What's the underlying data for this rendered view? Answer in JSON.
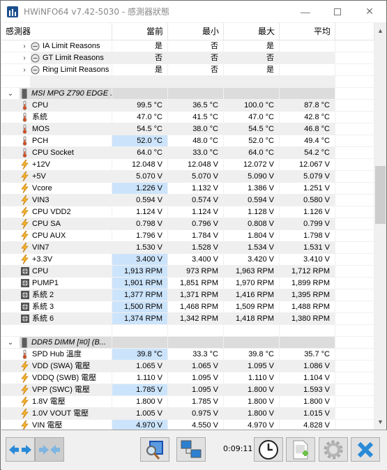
{
  "window": {
    "title": "HWiNFO64 v7.42-5030 - 感測器狀態",
    "minimize_glyph": "—",
    "close_glyph": "✕"
  },
  "columns": [
    "感測器",
    "當前",
    "最小",
    "最大",
    "平均"
  ],
  "rows": [
    {
      "type": "item",
      "indent": 2,
      "expander": "›",
      "icon": "clock-icon",
      "label": "IA Limit Reasons",
      "values": [
        "是",
        "否",
        "是",
        ""
      ],
      "highlight": [
        false,
        false,
        false,
        false
      ]
    },
    {
      "type": "item",
      "indent": 2,
      "expander": "›",
      "icon": "clock-icon",
      "label": "GT Limit Reasons",
      "values": [
        "否",
        "否",
        "否",
        ""
      ],
      "highlight": [
        false,
        false,
        false,
        false
      ]
    },
    {
      "type": "item",
      "indent": 2,
      "expander": "›",
      "icon": "clock-icon",
      "label": "Ring Limit Reasons",
      "values": [
        "是",
        "否",
        "是",
        ""
      ],
      "highlight": [
        false,
        false,
        false,
        false
      ]
    },
    {
      "type": "blank"
    },
    {
      "type": "section",
      "expander": "⌄",
      "icon": "chip-icon",
      "label": "MSI MPG Z790 EDGE ..."
    },
    {
      "type": "item",
      "icon": "thermometer-icon",
      "label": "CPU",
      "values": [
        "99.5 °C",
        "36.5 °C",
        "100.0 °C",
        "87.8 °C"
      ],
      "highlight": [
        false,
        false,
        false,
        false
      ]
    },
    {
      "type": "item",
      "icon": "thermometer-icon",
      "label": "系統",
      "values": [
        "47.0 °C",
        "41.5 °C",
        "47.0 °C",
        "42.8 °C"
      ],
      "highlight": [
        false,
        false,
        false,
        false
      ]
    },
    {
      "type": "item",
      "icon": "thermometer-icon",
      "label": "MOS",
      "values": [
        "54.5 °C",
        "38.0 °C",
        "54.5 °C",
        "46.8 °C"
      ],
      "highlight": [
        false,
        false,
        false,
        false
      ]
    },
    {
      "type": "item",
      "icon": "thermometer-icon",
      "label": "PCH",
      "values": [
        "52.0 °C",
        "48.0 °C",
        "52.0 °C",
        "49.4 °C"
      ],
      "highlight": [
        true,
        false,
        false,
        false
      ]
    },
    {
      "type": "item",
      "icon": "thermometer-icon",
      "label": "CPU Socket",
      "values": [
        "64.0 °C",
        "33.0 °C",
        "64.0 °C",
        "54.2 °C"
      ],
      "highlight": [
        false,
        false,
        false,
        false
      ]
    },
    {
      "type": "item",
      "icon": "lightning-icon",
      "label": "+12V",
      "values": [
        "12.048 V",
        "12.048 V",
        "12.072 V",
        "12.067 V"
      ],
      "highlight": [
        false,
        false,
        false,
        false
      ]
    },
    {
      "type": "item",
      "icon": "lightning-icon",
      "label": "+5V",
      "values": [
        "5.070 V",
        "5.070 V",
        "5.090 V",
        "5.079 V"
      ],
      "highlight": [
        false,
        false,
        false,
        false
      ]
    },
    {
      "type": "item",
      "icon": "lightning-icon",
      "label": "Vcore",
      "values": [
        "1.226 V",
        "1.132 V",
        "1.386 V",
        "1.251 V"
      ],
      "highlight": [
        true,
        false,
        false,
        false
      ]
    },
    {
      "type": "item",
      "icon": "lightning-icon",
      "label": "VIN3",
      "values": [
        "0.594 V",
        "0.574 V",
        "0.594 V",
        "0.580 V"
      ],
      "highlight": [
        false,
        false,
        false,
        false
      ]
    },
    {
      "type": "item",
      "icon": "lightning-icon",
      "label": "CPU VDD2",
      "values": [
        "1.124 V",
        "1.124 V",
        "1.128 V",
        "1.126 V"
      ],
      "highlight": [
        false,
        false,
        false,
        false
      ]
    },
    {
      "type": "item",
      "icon": "lightning-icon",
      "label": "CPU SA",
      "values": [
        "0.798 V",
        "0.796 V",
        "0.808 V",
        "0.799 V"
      ],
      "highlight": [
        false,
        false,
        false,
        false
      ]
    },
    {
      "type": "item",
      "icon": "lightning-icon",
      "label": "CPU AUX",
      "values": [
        "1.796 V",
        "1.784 V",
        "1.804 V",
        "1.798 V"
      ],
      "highlight": [
        false,
        false,
        false,
        false
      ]
    },
    {
      "type": "item",
      "icon": "lightning-icon",
      "label": "VIN7",
      "values": [
        "1.530 V",
        "1.528 V",
        "1.534 V",
        "1.531 V"
      ],
      "highlight": [
        false,
        false,
        false,
        false
      ]
    },
    {
      "type": "item",
      "icon": "lightning-icon",
      "label": "+3.3V",
      "values": [
        "3.400 V",
        "3.400 V",
        "3.420 V",
        "3.410 V"
      ],
      "highlight": [
        true,
        false,
        false,
        false
      ]
    },
    {
      "type": "item",
      "icon": "fan-icon",
      "label": "CPU",
      "values": [
        "1,913 RPM",
        "973 RPM",
        "1,963 RPM",
        "1,712 RPM"
      ],
      "highlight": [
        true,
        false,
        false,
        false
      ]
    },
    {
      "type": "item",
      "icon": "fan-icon",
      "label": "PUMP1",
      "values": [
        "1,901 RPM",
        "1,851 RPM",
        "1,970 RPM",
        "1,899 RPM"
      ],
      "highlight": [
        true,
        false,
        false,
        false
      ]
    },
    {
      "type": "item",
      "icon": "fan-icon",
      "label": "系統 2",
      "values": [
        "1,377 RPM",
        "1,371 RPM",
        "1,416 RPM",
        "1,395 RPM"
      ],
      "highlight": [
        true,
        false,
        false,
        false
      ]
    },
    {
      "type": "item",
      "icon": "fan-icon",
      "label": "系統 3",
      "values": [
        "1,500 RPM",
        "1,468 RPM",
        "1,509 RPM",
        "1,488 RPM"
      ],
      "highlight": [
        true,
        false,
        false,
        false
      ]
    },
    {
      "type": "item",
      "icon": "fan-icon",
      "label": "系統 6",
      "values": [
        "1,374 RPM",
        "1,342 RPM",
        "1,418 RPM",
        "1,380 RPM"
      ],
      "highlight": [
        true,
        false,
        false,
        false
      ]
    },
    {
      "type": "blank"
    },
    {
      "type": "section",
      "expander": "⌄",
      "icon": "chip-icon",
      "label": "DDR5 DIMM [#0] (B..."
    },
    {
      "type": "item",
      "icon": "thermometer-icon",
      "label": "SPD Hub 溫度",
      "values": [
        "39.8 °C",
        "33.3 °C",
        "39.8 °C",
        "35.7 °C"
      ],
      "highlight": [
        true,
        false,
        false,
        false
      ]
    },
    {
      "type": "item",
      "icon": "lightning-icon",
      "label": "VDD (SWA) 電壓",
      "values": [
        "1.065 V",
        "1.065 V",
        "1.095 V",
        "1.086 V"
      ],
      "highlight": [
        false,
        false,
        false,
        false
      ]
    },
    {
      "type": "item",
      "icon": "lightning-icon",
      "label": "VDDQ (SWB) 電壓",
      "values": [
        "1.110 V",
        "1.095 V",
        "1.110 V",
        "1.104 V"
      ],
      "highlight": [
        false,
        false,
        false,
        false
      ]
    },
    {
      "type": "item",
      "icon": "lightning-icon",
      "label": "VPP (SWC) 電壓",
      "values": [
        "1.785 V",
        "1.095 V",
        "1.800 V",
        "1.593 V"
      ],
      "highlight": [
        true,
        false,
        false,
        false
      ]
    },
    {
      "type": "item",
      "icon": "lightning-icon",
      "label": "1.8V 電壓",
      "values": [
        "1.800 V",
        "1.785 V",
        "1.800 V",
        "1.800 V"
      ],
      "highlight": [
        false,
        false,
        false,
        false
      ]
    },
    {
      "type": "item",
      "icon": "lightning-icon",
      "label": "1.0V VOUT 電壓",
      "values": [
        "1.005 V",
        "0.975 V",
        "1.800 V",
        "1.015 V"
      ],
      "highlight": [
        false,
        false,
        false,
        false
      ]
    },
    {
      "type": "item",
      "icon": "lightning-icon",
      "label": "VIN 電壓",
      "values": [
        "4.970 V",
        "4.550 V",
        "4.970 V",
        "4.828 V"
      ],
      "highlight": [
        true,
        false,
        false,
        false
      ]
    }
  ],
  "scrollbar": {
    "position_fraction": 0.34,
    "visible_fraction": 0.14
  },
  "toolbar": {
    "timer": "0:09:11",
    "buttons": [
      {
        "name": "expand-columns-button",
        "icon": "arrows-out-icon"
      },
      {
        "name": "collapse-columns-button",
        "icon": "arrows-in-icon"
      },
      {
        "name": "sensor-monitor-button",
        "icon": "monitor-magnifier-icon"
      },
      {
        "name": "network-button",
        "icon": "network-computers-icon"
      },
      {
        "name": "reset-timer-button",
        "icon": "clock-icon"
      },
      {
        "name": "log-button",
        "icon": "add-log-icon"
      },
      {
        "name": "settings-button",
        "icon": "gear-icon"
      },
      {
        "name": "close-button",
        "icon": "close-icon"
      }
    ]
  },
  "colors": {
    "highlight": "#cce4fb",
    "section_bg": "#dcdcdc",
    "alt_row": "#efefef",
    "accent_blue": "#2a8ad8"
  }
}
